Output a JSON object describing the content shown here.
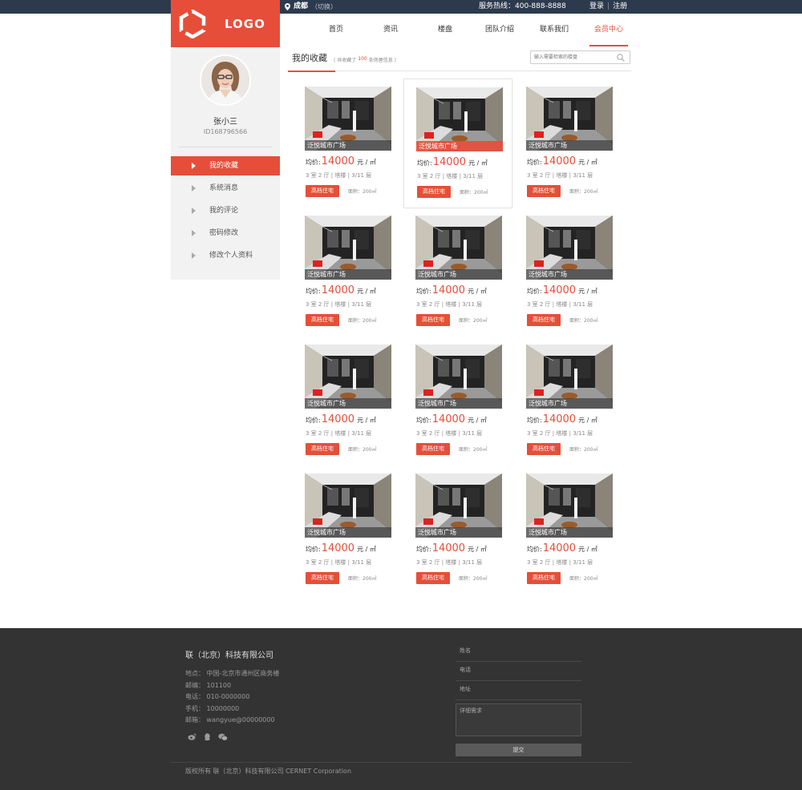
{
  "topbar": {
    "city": "成都",
    "city_switch": "（切换）",
    "hotline": "服务热线：400-888-8888",
    "login": "登录",
    "separator": "|",
    "register": "注册"
  },
  "logo": {
    "text": "LOGO"
  },
  "nav": {
    "items": [
      {
        "label": "首页"
      },
      {
        "label": "资讯"
      },
      {
        "label": "楼盘"
      },
      {
        "label": "团队介绍"
      },
      {
        "label": "联系我们"
      },
      {
        "label": "会员中心"
      }
    ],
    "active_index": 5
  },
  "sidebar": {
    "username": "张小三",
    "user_id": "ID168796566",
    "menu": [
      {
        "label": "我的收藏"
      },
      {
        "label": "系统消息"
      },
      {
        "label": "我的评论"
      },
      {
        "label": "密码修改"
      },
      {
        "label": "修改个人资料"
      }
    ],
    "active_index": 0
  },
  "section": {
    "title": "我的收藏",
    "note_prefix": "( 共收藏了",
    "note_count": "100",
    "note_suffix": "条房屋信息 )",
    "search_placeholder": "输入需要检索的楼盘"
  },
  "listing": {
    "caption": "泛悦城市广场",
    "price_label": "均价:",
    "price_value": "14000",
    "price_unit": "元 / ㎡",
    "specs": "3 室 2 厅 | 塔楼 | 3/11 层",
    "tag": "高档住宅",
    "area": "面积：200㎡"
  },
  "listing_count": 12,
  "hover_index": 1,
  "footer": {
    "company": "联（北京）科技有限公司",
    "lines": [
      "地点：  中国-北京市通州区商务楼",
      "邮编：  101100",
      "电话：  010-0000000",
      "手机：  10000000",
      "邮箱：  wangyue@00000000"
    ],
    "form": {
      "name": "姓名",
      "phone": "电话",
      "address": "地址",
      "message": "详细需求",
      "submit": "提交"
    },
    "copyright": "版权所有 联（北京）科技有限公司 CERNET Corporation"
  },
  "colors": {
    "accent": "#e64e39",
    "topbar": "#2d3a4d",
    "footer": "#333333"
  }
}
